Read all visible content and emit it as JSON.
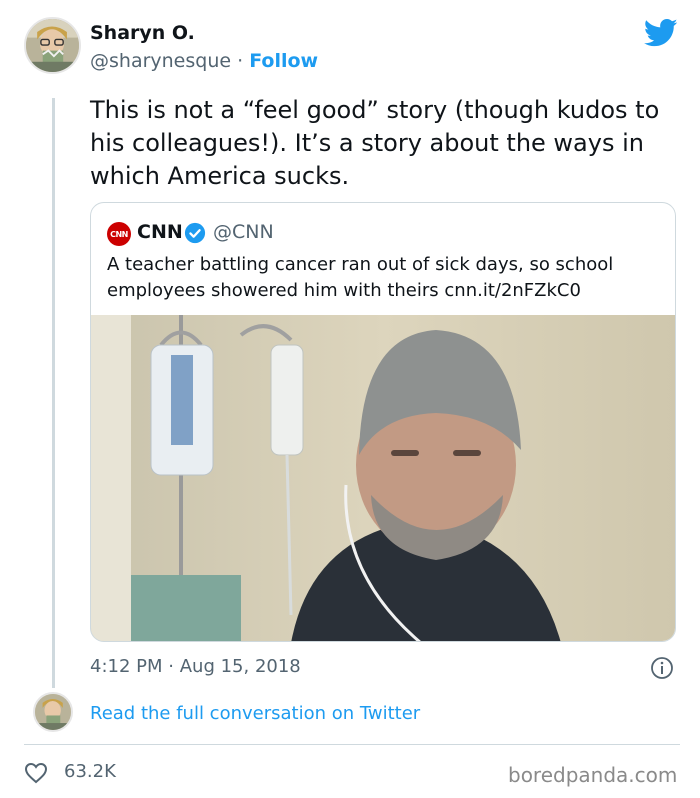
{
  "author": {
    "name": "Sharyn O.",
    "handle": "@sharynesque",
    "separator": "·",
    "follow_label": "Follow"
  },
  "tweet": {
    "text": "This is not a “feel good” story (though kudos to his colleagues!). It’s a story about the ways in which America sucks.",
    "time": "4:12 PM",
    "separator": "·",
    "date": "Aug 15, 2018"
  },
  "quote": {
    "logo_text": "CNN",
    "name": "CNN",
    "handle": "@CNN",
    "text": "A teacher battling cancer ran out of sick days, so school employees showered him with theirs cnn.it/2nFZkC0"
  },
  "footer": {
    "read_link": "Read the full conversation on Twitter",
    "likes": "63.2K",
    "watermark": "boredpanda.com"
  },
  "colors": {
    "accent": "#1d9bf0",
    "text": "#0f1419",
    "muted": "#536471",
    "border": "#cfd9de",
    "cnn_red": "#cc0000"
  },
  "icons": [
    "twitter-bird-icon",
    "verified-badge-icon",
    "info-icon",
    "heart-icon"
  ]
}
